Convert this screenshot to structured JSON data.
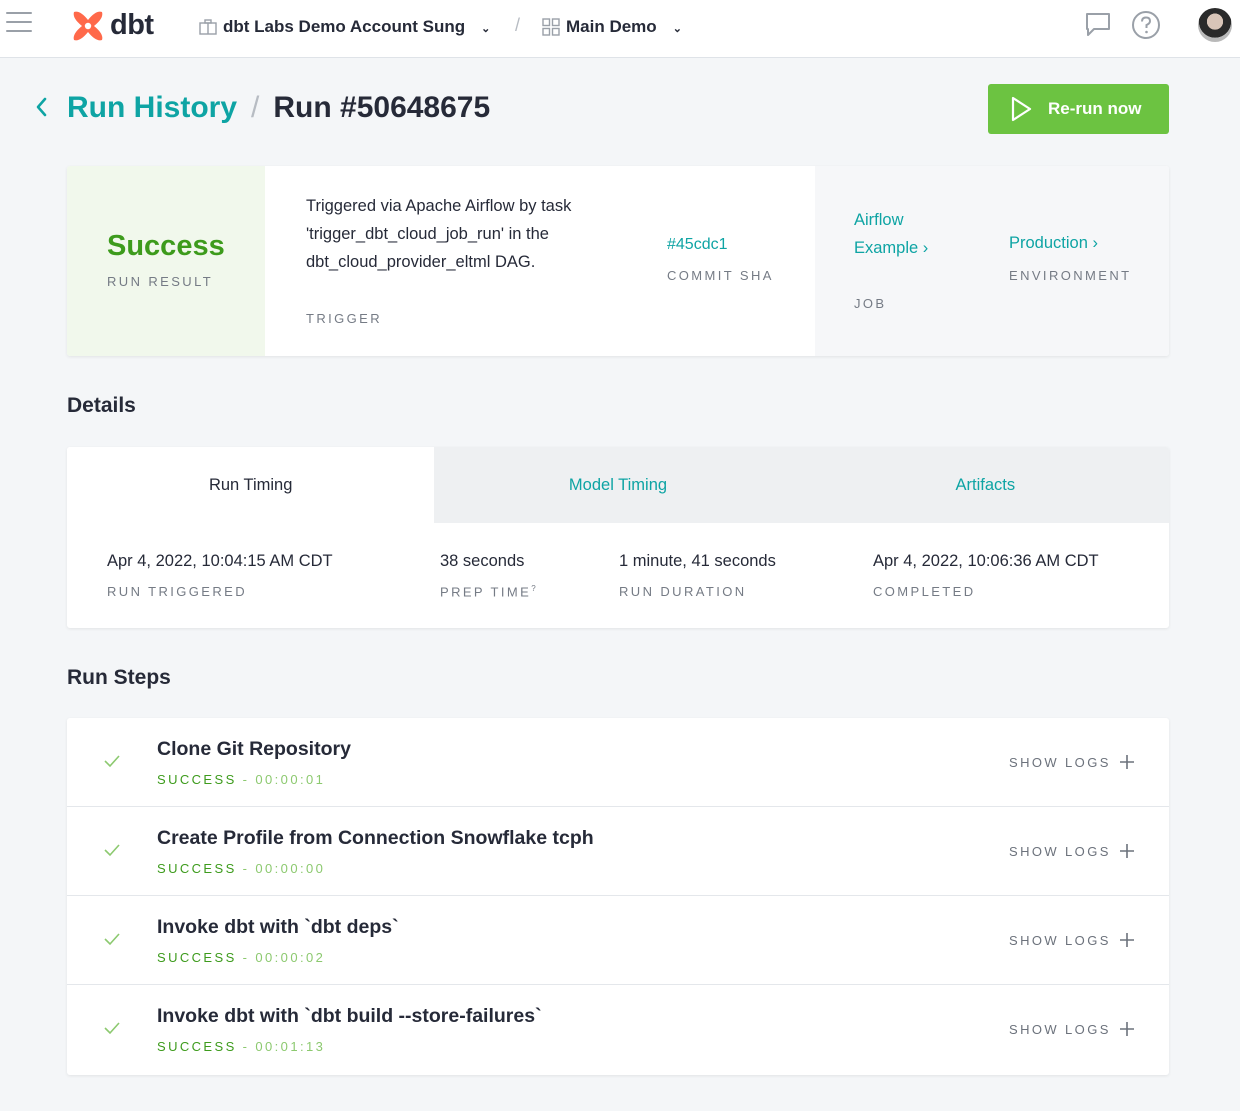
{
  "topbar": {
    "logo_text": "dbt",
    "account": "dbt Labs Demo Account Sung",
    "separator": "/",
    "project": "Main Demo"
  },
  "header": {
    "breadcrumb_link": "Run History",
    "breadcrumb_sep": "/",
    "title": "Run #50648675",
    "rerun_label": "Re-run now"
  },
  "summary": {
    "result": "Success",
    "result_label": "RUN RESULT",
    "trigger_text": "Triggered via Apache Airflow by task 'trigger_dbt_cloud_job_run' in the dbt_cloud_provider_eltml DAG.",
    "trigger_label": "TRIGGER",
    "commit_sha": "#45cdc1",
    "commit_sha_label": "COMMIT SHA",
    "job": "Airflow Example ›",
    "job_label": "JOB",
    "environment": "Production ›",
    "environment_label": "ENVIRONMENT"
  },
  "details": {
    "title": "Details",
    "tabs": [
      "Run Timing",
      "Model Timing",
      "Artifacts"
    ],
    "active_tab": "Run Timing",
    "timing": [
      {
        "value": "Apr 4, 2022, 10:04:15 AM CDT",
        "label": "RUN TRIGGERED"
      },
      {
        "value": "38 seconds",
        "label": "PREP TIME",
        "sup": "?"
      },
      {
        "value": "1 minute, 41 seconds",
        "label": "RUN DURATION"
      },
      {
        "value": "Apr 4, 2022, 10:06:36 AM CDT",
        "label": "COMPLETED"
      }
    ]
  },
  "run_steps": {
    "title": "Run Steps",
    "show_logs_label": "SHOW LOGS",
    "steps": [
      {
        "name": "Clone Git Repository",
        "status": "SUCCESS",
        "duration": "- 00:00:01"
      },
      {
        "name": "Create Profile from Connection Snowflake tcph",
        "status": "SUCCESS",
        "duration": "- 00:00:00"
      },
      {
        "name": "Invoke dbt with `dbt deps`",
        "status": "SUCCESS",
        "duration": "- 00:00:02"
      },
      {
        "name": "Invoke dbt with `dbt build --store-failures`",
        "status": "SUCCESS",
        "duration": "- 00:01:13"
      }
    ]
  },
  "colors": {
    "accent": "#0ea4a4",
    "success": "#3d9b1c",
    "button": "#6cc341",
    "logo": "#ff694a"
  }
}
